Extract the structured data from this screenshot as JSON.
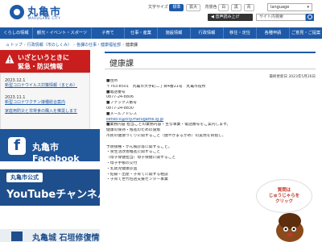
{
  "header": {
    "logo": "丸亀市",
    "logo_sub": "MARUGAME CITY",
    "text_size_label": "文字サイズ",
    "text_size_options": [
      "標準",
      "拡大"
    ],
    "bg_color_label": "背景色",
    "bg_color_options": [
      "白",
      "黒",
      "青"
    ],
    "voice_button": "音声読み上げ",
    "search_placeholder": "サイト内検索",
    "language": "language"
  },
  "nav": [
    "くらしの情報",
    "観光・イベント・スポーツ",
    "子育て",
    "仕事・産業",
    "施設情報",
    "行政情報",
    "移住・定住",
    "各種申請",
    "ご意見・ご提案"
  ],
  "breadcrumb": [
    "トップ",
    "行政情報（市のしくみ）",
    "各課の仕事・健康福祉部",
    "健康課"
  ],
  "sidebar": {
    "emergency_line1": "いざというときに",
    "emergency_line2": "緊急・防災情報",
    "news": [
      {
        "date": "2023.12.1",
        "text": "新型コロナウイルス対策情報（まとめ）"
      },
      {
        "date": "2023.11.1",
        "text": "新型コロナワクチン接種総合案内"
      },
      {
        "date": "",
        "text": "家庭用防災と非常食の購入を推奨します"
      }
    ],
    "facebook": "丸亀市 Facebook",
    "youtube_label": "丸亀市公式",
    "youtube": "YouTubeチャンネル",
    "banner3": "丸亀城 石垣修復情報"
  },
  "main": {
    "title": "健康課",
    "updated": "最終更新日 2023年5月26日",
    "lines": [
      "■住所",
      "〒763-8501　丸亀市大手町二丁目4番21号　丸亀市役所",
      "■電話番号",
      "0877-24-8806",
      "■ファックス番号",
      "0877-24-8830",
      "■メールアドレス",
      "kenko-k@city.marugame.lg.jp",
      "■業務内容 担当ごとの業務内容・主な事業・電話番号をご案内します。",
      "健康の保持・増進のための施策",
      "市民の健康づくりに関すること（健やかまるがめ）の実現を目指し、",
      "",
      "予防接種・がん検診等に関すること。",
      "・食生活改善推進に関すること",
      "（母子保健担当）母子保健に関すること",
      "・母子手帳の交付",
      "・乳幼児健康診査",
      "・妊婦・出産・子育てに関する相談",
      "・子育て世代包括支援センター事業"
    ]
  },
  "mascot": {
    "bubble_line1": "質問は",
    "bubble_line2": "じゅうじゃらを",
    "bubble_line3": "クリック"
  },
  "colors": {
    "primary": "#1e5aa8",
    "emergency": "#c81e1e",
    "facebook": "#1f5599"
  }
}
